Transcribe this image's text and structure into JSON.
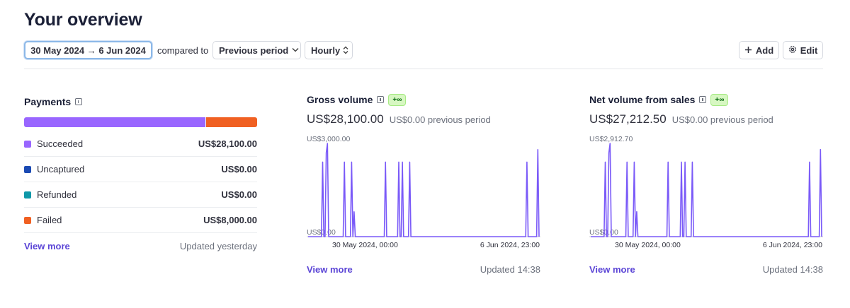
{
  "page": {
    "title": "Your overview"
  },
  "toolbar": {
    "date_range": "30 May 2024 → 6 Jun 2024",
    "compared_label": "compared to",
    "compare_option": "Previous period",
    "interval_option": "Hourly",
    "add_label": "Add",
    "edit_label": "Edit"
  },
  "payments": {
    "title": "Payments",
    "segments": [
      {
        "label": "Succeeded",
        "value": "US$28,100.00",
        "amount": 28100,
        "color": "#9966ff"
      },
      {
        "label": "Uncaptured",
        "value": "US$0.00",
        "amount": 0,
        "color": "#1b4ab3"
      },
      {
        "label": "Refunded",
        "value": "US$0.00",
        "amount": 0,
        "color": "#0e98a8"
      },
      {
        "label": "Failed",
        "value": "US$8,000.00",
        "amount": 8000,
        "color": "#f06022"
      }
    ],
    "view_more": "View more",
    "updated": "Updated yesterday"
  },
  "gross": {
    "title": "Gross volume",
    "badge": "+∞",
    "value": "US$28,100.00",
    "previous": "US$0.00 previous period",
    "view_more": "View more",
    "updated": "Updated 14:38"
  },
  "net": {
    "title": "Net volume from sales",
    "badge": "+∞",
    "value": "US$27,212.50",
    "previous": "US$0.00 previous period",
    "view_more": "View more",
    "updated": "Updated 14:38"
  },
  "chart_data": [
    {
      "type": "line",
      "y_max_label": "US$3,000.00",
      "y_min_label": "US$0.00",
      "x_start_label": "30 May 2024, 00:00",
      "x_end_label": "6 Jun 2024, 23:00",
      "ylim": [
        0,
        3000
      ],
      "x_range": [
        0,
        191
      ],
      "line_color": "#7a5af8",
      "points": [
        [
          0,
          0
        ],
        [
          11,
          0
        ],
        [
          12,
          2400
        ],
        [
          13,
          0
        ],
        [
          14,
          0
        ],
        [
          15,
          2700
        ],
        [
          16,
          3000
        ],
        [
          17,
          0
        ],
        [
          29,
          0
        ],
        [
          30,
          2400
        ],
        [
          31,
          0
        ],
        [
          35,
          0
        ],
        [
          36,
          2400
        ],
        [
          37,
          0
        ],
        [
          38,
          800
        ],
        [
          39,
          0
        ],
        [
          63,
          0
        ],
        [
          64,
          2400
        ],
        [
          65,
          0
        ],
        [
          74,
          0
        ],
        [
          75,
          2400
        ],
        [
          76,
          0
        ],
        [
          77,
          0
        ],
        [
          78,
          2400
        ],
        [
          79,
          0
        ],
        [
          83,
          0
        ],
        [
          84,
          2400
        ],
        [
          85,
          0
        ],
        [
          180,
          0
        ],
        [
          181,
          2400
        ],
        [
          182,
          0
        ],
        [
          189,
          0
        ],
        [
          190,
          2800
        ],
        [
          191,
          0
        ]
      ]
    },
    {
      "type": "line",
      "y_max_label": "US$2,912.70",
      "y_min_label": "US$0.00",
      "x_start_label": "30 May 2024, 00:00",
      "x_end_label": "6 Jun 2024, 23:00",
      "ylim": [
        0,
        2912.7
      ],
      "x_range": [
        0,
        191
      ],
      "line_color": "#7a5af8",
      "points": [
        [
          0,
          0
        ],
        [
          11,
          0
        ],
        [
          12,
          2330
        ],
        [
          13,
          0
        ],
        [
          14,
          0
        ],
        [
          15,
          2620
        ],
        [
          16,
          2912.7
        ],
        [
          17,
          0
        ],
        [
          29,
          0
        ],
        [
          30,
          2330
        ],
        [
          31,
          0
        ],
        [
          35,
          0
        ],
        [
          36,
          2330
        ],
        [
          37,
          0
        ],
        [
          38,
          780
        ],
        [
          39,
          0
        ],
        [
          63,
          0
        ],
        [
          64,
          2330
        ],
        [
          65,
          0
        ],
        [
          74,
          0
        ],
        [
          75,
          2330
        ],
        [
          76,
          0
        ],
        [
          77,
          0
        ],
        [
          78,
          2330
        ],
        [
          79,
          0
        ],
        [
          83,
          0
        ],
        [
          84,
          2330
        ],
        [
          85,
          0
        ],
        [
          180,
          0
        ],
        [
          181,
          2330
        ],
        [
          182,
          0
        ],
        [
          189,
          0
        ],
        [
          190,
          2720
        ],
        [
          191,
          0
        ]
      ]
    }
  ]
}
